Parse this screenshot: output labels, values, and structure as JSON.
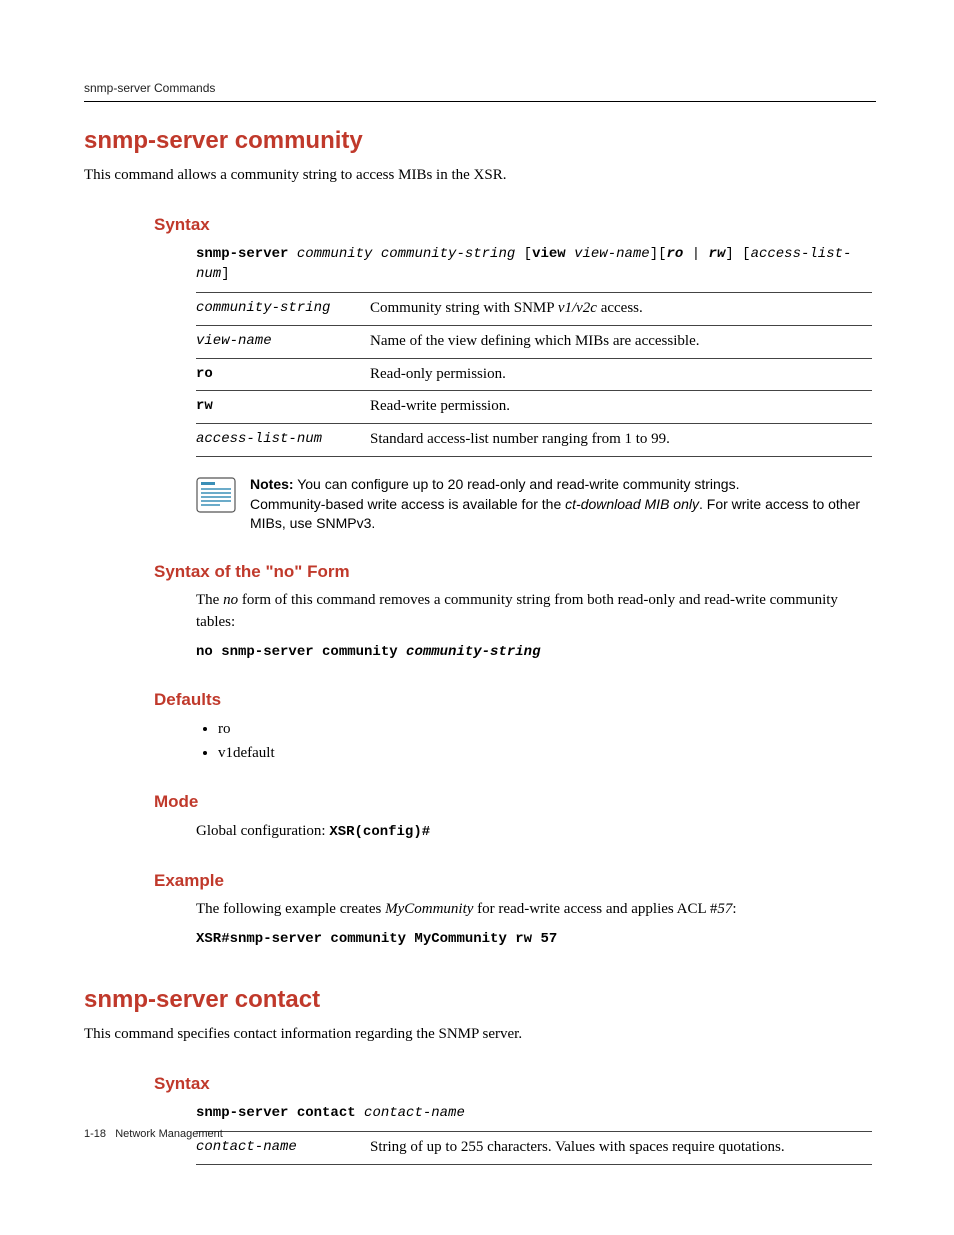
{
  "header": {
    "running": "snmp-server Commands"
  },
  "cmd1": {
    "title": "snmp-server community",
    "intro": "This command allows a community string to access MIBs in the XSR.",
    "syntax": {
      "heading": "Syntax",
      "line_parts": {
        "a": "snmp-server",
        "b": " community community-string ",
        "c": "[",
        "d": "view",
        "e": " view-name",
        "f": "][",
        "g": "ro",
        "h": " | ",
        "i": "rw",
        "j": "] [",
        "k": "access-list-num",
        "l": "]"
      },
      "rows": [
        {
          "term": "community-string",
          "term_style": "ital",
          "desc_pre": "Community string with SNMP ",
          "desc_em": "v1/v2c",
          "desc_post": " access."
        },
        {
          "term": "view-name",
          "term_style": "ital",
          "desc_pre": "Name of the view defining which MIBs are accessible.",
          "desc_em": "",
          "desc_post": ""
        },
        {
          "term": "ro",
          "term_style": "bold",
          "desc_pre": "Read-only permission.",
          "desc_em": "",
          "desc_post": ""
        },
        {
          "term": "rw",
          "term_style": "bold",
          "desc_pre": "Read-write permission.",
          "desc_em": "",
          "desc_post": ""
        },
        {
          "term": "access-list-num",
          "term_style": "ital",
          "desc_pre": "Standard access-list number ranging from 1 to 99.",
          "desc_em": "",
          "desc_post": ""
        }
      ]
    },
    "note": {
      "label": "Notes:",
      "line1": " You can configure up to 20 read-only and read-write community strings.",
      "line2a": "Community-based write access is available for the ",
      "line2em": "ct-download MIB only",
      "line2b": ". For write access to other MIBs, use SNMPv3."
    },
    "noform": {
      "heading": "Syntax of the \"no\" Form",
      "text_a": "The ",
      "text_em": "no",
      "text_b": " form of this command removes a community string from both read-only and read-write community tables:",
      "code_a": "no snmp-server community ",
      "code_b": "community-string"
    },
    "defaults": {
      "heading": "Defaults",
      "items": [
        "ro",
        "v1default"
      ]
    },
    "mode": {
      "heading": "Mode",
      "text": "Global configuration: ",
      "code": "XSR(config)#"
    },
    "example": {
      "heading": "Example",
      "text_a": "The following example creates ",
      "text_em1": "MyCommunity",
      "text_b": " for read-write access and applies ACL #",
      "text_em2": "57",
      "text_c": ":",
      "code": "XSR#snmp-server community MyCommunity rw 57"
    }
  },
  "cmd2": {
    "title": "snmp-server contact",
    "intro": "This command specifies contact information regarding the SNMP server.",
    "syntax": {
      "heading": "Syntax",
      "line_a": "snmp-server contact",
      "line_b": " contact-name",
      "rows": [
        {
          "term": "contact-name",
          "desc": "String of up to 255 characters. Values with spaces require quotations."
        }
      ]
    }
  },
  "footer": {
    "page": "1-18",
    "label": "Network Management"
  }
}
